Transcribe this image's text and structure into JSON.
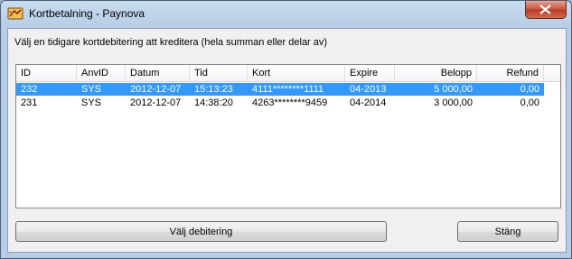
{
  "window": {
    "title": "Kortbetalning - Paynova"
  },
  "instruction": "Välj en tidigare kortdebitering att kreditera (hela summan eller delar av)",
  "table": {
    "columns": [
      "ID",
      "AnvID",
      "Datum",
      "Tid",
      "Kort",
      "Expire",
      "Belopp",
      "Refund"
    ],
    "rows": [
      {
        "id": "232",
        "anvid": "SYS",
        "datum": "2012-12-07",
        "tid": "15:13:23",
        "kort": "4111********1111",
        "expire": "04-2013",
        "belopp": "5 000,00",
        "refund": "0,00",
        "selected": true
      },
      {
        "id": "231",
        "anvid": "SYS",
        "datum": "2012-12-07",
        "tid": "14:38:20",
        "kort": "4263********9459",
        "expire": "04-2014",
        "belopp": "3 000,00",
        "refund": "0,00",
        "selected": false
      }
    ]
  },
  "buttons": {
    "select": "Välj debitering",
    "close": "Stäng"
  },
  "icons": {
    "app": "credit-card-icon",
    "close": "close-icon"
  }
}
